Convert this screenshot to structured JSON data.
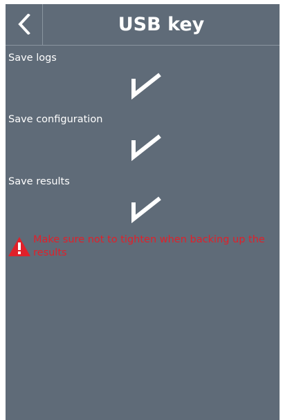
{
  "header": {
    "title": "USB key",
    "back_icon": "chevron-left-icon"
  },
  "options": [
    {
      "label": "Save logs",
      "checked": true,
      "icon": "check-icon"
    },
    {
      "label": "Save configuration",
      "checked": true,
      "icon": "check-icon"
    },
    {
      "label": "Save results",
      "checked": true,
      "icon": "check-icon"
    }
  ],
  "warning": {
    "icon": "warning-icon",
    "text": "Make sure not to tighten when backing up the results"
  },
  "colors": {
    "background": "#5f6b78",
    "text": "#ffffff",
    "warning_text": "#e0202a",
    "warning_icon": "#e0202a"
  }
}
